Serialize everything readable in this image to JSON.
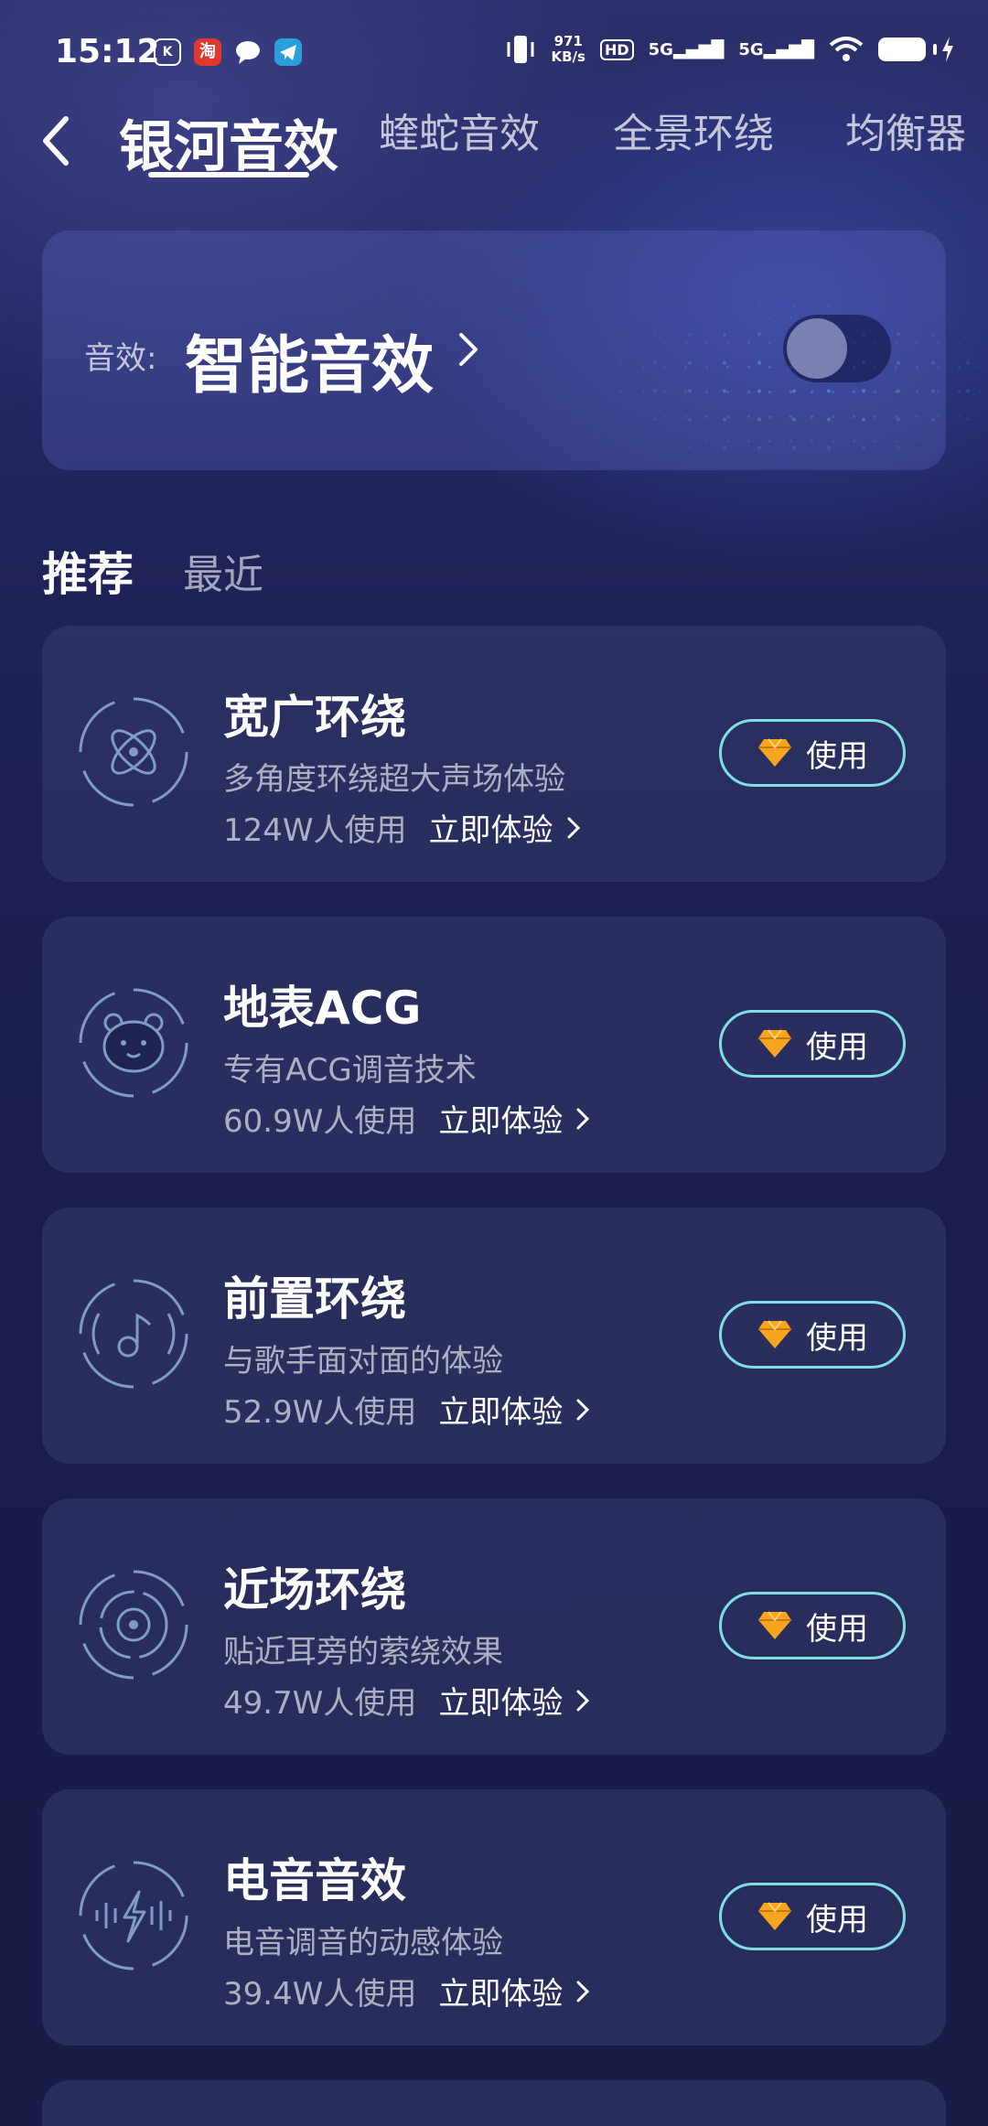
{
  "status_bar": {
    "time": "15:12",
    "apps": [
      {
        "name": "kuwo-app-icon",
        "glyph": "◉",
        "color": "#ffffff"
      },
      {
        "name": "taobao-app-icon",
        "glyph": "淘",
        "color": "#e0382e"
      },
      {
        "name": "message-app-icon",
        "glyph": "●",
        "color": "#ffffff"
      },
      {
        "name": "telegram-app-icon",
        "glyph": "➤",
        "color": "#2aa0da"
      }
    ],
    "speed_value": "971",
    "speed_unit": "KB/s",
    "hd_label": "HD",
    "signal_1": "5G",
    "signal_2": "5G"
  },
  "header": {
    "tabs": [
      {
        "label": "银河音效",
        "active": true
      },
      {
        "label": "蝰蛇音效",
        "active": false
      },
      {
        "label": "全景环绕",
        "active": false
      },
      {
        "label": "均衡器",
        "active": false
      }
    ]
  },
  "effect": {
    "label": "音效:",
    "value": "智能音效",
    "enabled": false
  },
  "subtabs": {
    "recommended": "推荐",
    "recent": "最近"
  },
  "items": [
    {
      "title": "宽广环绕",
      "desc": "多角度环绕超大声场体验",
      "users": "124W人使用",
      "try": "立即体验",
      "button": "使用",
      "icon": "atom-icon"
    },
    {
      "title": "地表ACG",
      "desc": "专有ACG调音技术",
      "users": "60.9W人使用",
      "try": "立即体验",
      "button": "使用",
      "icon": "bear-icon"
    },
    {
      "title": "前置环绕",
      "desc": "与歌手面对面的体验",
      "users": "52.9W人使用",
      "try": "立即体验",
      "button": "使用",
      "icon": "music-note-icon"
    },
    {
      "title": "近场环绕",
      "desc": "贴近耳旁的萦绕效果",
      "users": "49.7W人使用",
      "try": "立即体验",
      "button": "使用",
      "icon": "speaker-icon"
    },
    {
      "title": "电音音效",
      "desc": "电音调音的动感体验",
      "users": "39.4W人使用",
      "try": "立即体验",
      "button": "使用",
      "icon": "lightning-wave-icon"
    }
  ],
  "colors": {
    "accent": "#7fe0e2",
    "diamond": "#f7a51e",
    "icon_stroke": "#7f9bc7"
  }
}
